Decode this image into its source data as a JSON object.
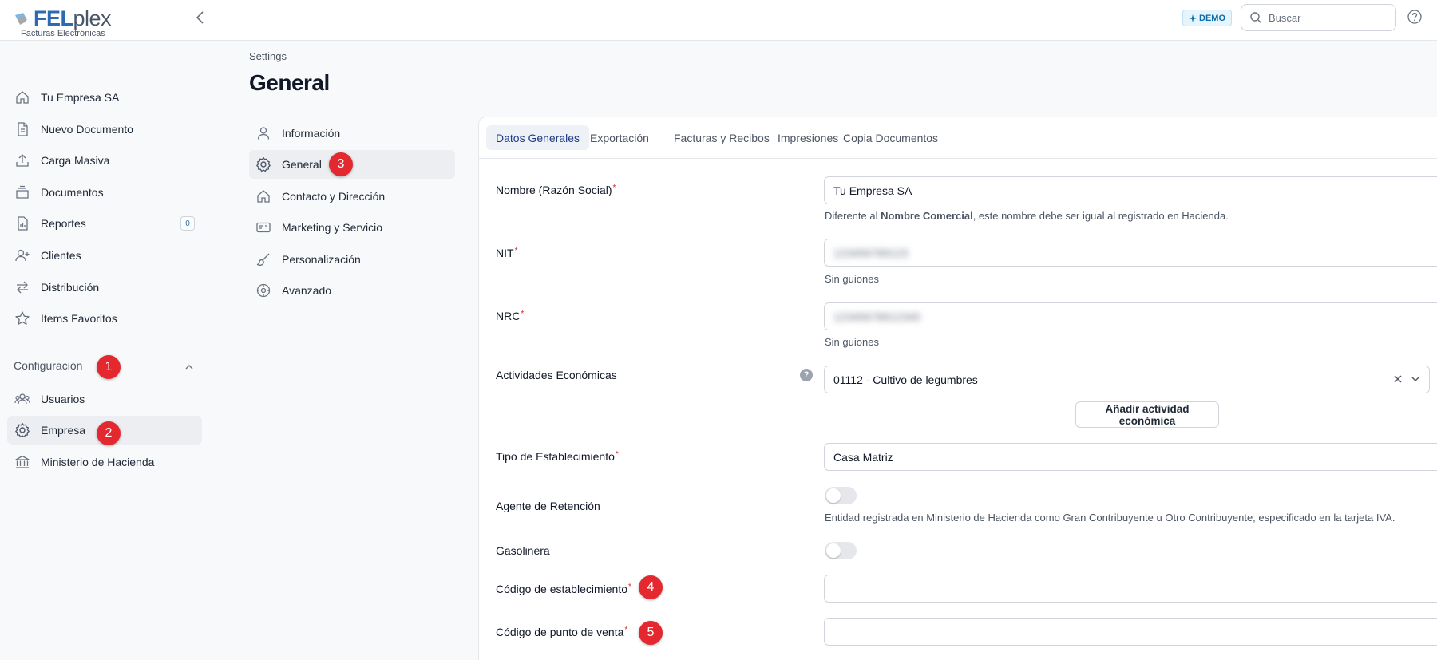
{
  "app": {
    "logo_text_main": "FEL",
    "logo_text_sub": "plex",
    "logo_tagline": "Facturas Electrónicas"
  },
  "topbar": {
    "demo_badge": "DEMO",
    "search_placeholder": "Buscar"
  },
  "sidebar": {
    "items": [
      {
        "label": "Tu Empresa SA",
        "icon": "home-icon"
      },
      {
        "label": "Nuevo Documento",
        "icon": "document-icon"
      },
      {
        "label": "Carga Masiva",
        "icon": "upload-icon"
      },
      {
        "label": "Documentos",
        "icon": "stack-icon"
      },
      {
        "label": "Reportes",
        "icon": "report-icon",
        "badge": "0"
      },
      {
        "label": "Clientes",
        "icon": "add-user-icon"
      },
      {
        "label": "Distribución",
        "icon": "arrows-icon"
      },
      {
        "label": "Items Favoritos",
        "icon": "star-icon"
      }
    ],
    "config_section": "Configuración",
    "config_items": [
      {
        "label": "Usuarios",
        "icon": "users-icon"
      },
      {
        "label": "Empresa",
        "icon": "gear-icon"
      },
      {
        "label": "Ministerio de Hacienda",
        "icon": "bank-icon"
      }
    ]
  },
  "page": {
    "breadcrumb": "Settings",
    "title": "General"
  },
  "settings_menu": [
    {
      "label": "Información",
      "icon": "user-icon"
    },
    {
      "label": "General",
      "icon": "gear-icon"
    },
    {
      "label": "Contacto y Dirección",
      "icon": "home-icon"
    },
    {
      "label": "Marketing y Servicio",
      "icon": "card-icon"
    },
    {
      "label": "Personalización",
      "icon": "brush-icon"
    },
    {
      "label": "Avanzado",
      "icon": "dial-icon"
    }
  ],
  "tabs": [
    "Datos Generales",
    "Exportación",
    "Facturas y Recibos",
    "Impresiones",
    "Copia Documentos"
  ],
  "form": {
    "nombre_label": "Nombre (Razón Social)",
    "nombre_value": "Tu Empresa SA",
    "nombre_hint_pre": "Diferente al ",
    "nombre_hint_bold": "Nombre Comercial",
    "nombre_hint_post": ", este nombre debe ser igual al registrado en Hacienda.",
    "nit_label": "NIT",
    "nit_value": "123456789123",
    "nit_hint": "Sin guiones",
    "nrc_label": "NRC",
    "nrc_value": "12345678912345",
    "nrc_hint": "Sin guiones",
    "actividades_label": "Actividades Económicas",
    "actividades_value": "01112 - Cultivo de legumbres",
    "add_actividad": "Añadir actividad económica",
    "tipo_label": "Tipo de Establecimiento",
    "tipo_value": "Casa Matriz",
    "agente_label": "Agente de Retención",
    "agente_hint": "Entidad registrada en Ministerio de Hacienda como Gran Contribuyente u Otro Contribuyente, especificado en la tarjeta IVA.",
    "gasolinera_label": "Gasolinera",
    "codigo_est_label": "Código de establecimiento",
    "codigo_pv_label": "Código de punto de venta",
    "help_mark": "?",
    "required_mark": "*"
  },
  "markers": [
    "1",
    "2",
    "3",
    "4",
    "5"
  ],
  "colors": {
    "accent": "#2b6cb0",
    "marker": "#e3282f"
  }
}
